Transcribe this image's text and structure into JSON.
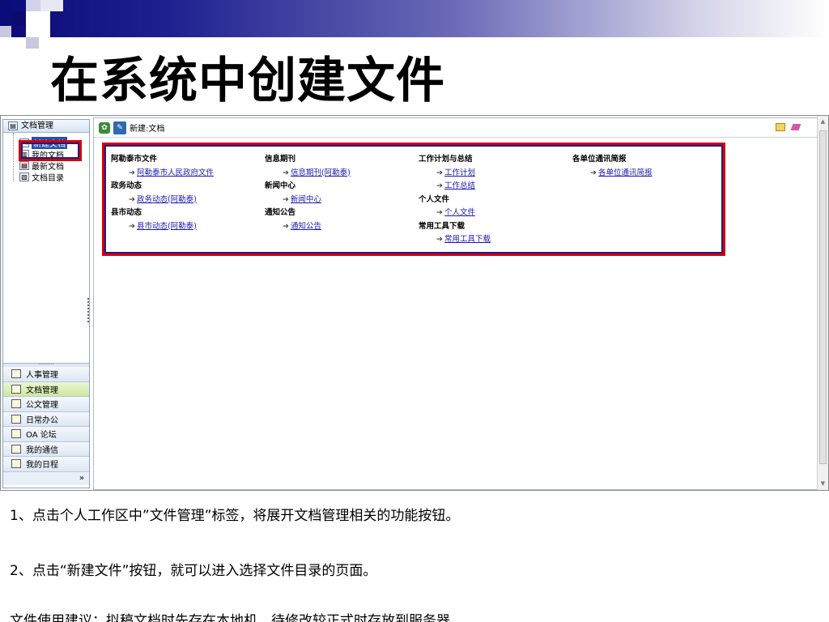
{
  "slide": {
    "title": "在系统中创建文件",
    "captions": [
      "1、点击个人工作区中”文件管理”标签，将展开文档管理相关的功能按钮。",
      "2、点击“新建文件”按钮，就可以进入选择文件目录的页面。",
      "文件使用建议：拟稿文档时先存在本地机，待修改较正式时存放到服务器"
    ]
  },
  "sidebar": {
    "header": "文档管理",
    "tree": [
      {
        "label": "新建文档",
        "selected": true,
        "icon": "new-doc-icon"
      },
      {
        "label": "我的文档",
        "selected": false,
        "icon": "my-doc-icon"
      },
      {
        "label": "最新文档",
        "selected": false,
        "icon": "latest-doc-icon"
      },
      {
        "label": "文档目录",
        "selected": false,
        "icon": "doc-catalog-icon"
      }
    ],
    "modules": [
      {
        "label": "人事管理",
        "icon": "personnel-icon",
        "active": false
      },
      {
        "label": "文档管理",
        "icon": "book-icon",
        "active": true
      },
      {
        "label": "公文管理",
        "icon": "official-doc-icon",
        "active": false
      },
      {
        "label": "日常办公",
        "icon": "office-icon",
        "active": false
      },
      {
        "label": "OA 论坛",
        "icon": "forum-icon",
        "active": false
      },
      {
        "label": "我的通信",
        "icon": "mail-icon",
        "active": false
      },
      {
        "label": "我的日程",
        "icon": "schedule-icon",
        "active": false
      }
    ],
    "more": "»"
  },
  "toolbar": {
    "label": "新建:文档"
  },
  "categories": [
    {
      "groups": [
        {
          "title": "阿勒泰市文件",
          "links": [
            "阿勒泰市人民政府文件"
          ]
        },
        {
          "title": "政务动态",
          "links": [
            "政务动态(阿勒泰)"
          ]
        },
        {
          "title": "县市动态",
          "links": [
            "县市动态(阿勒泰)"
          ]
        }
      ]
    },
    {
      "groups": [
        {
          "title": "信息期刊",
          "links": [
            "信息期刊(阿勒泰)"
          ]
        },
        {
          "title": "新闻中心",
          "links": [
            "新闻中心"
          ]
        },
        {
          "title": "通知公告",
          "links": [
            "通知公告"
          ]
        }
      ]
    },
    {
      "groups": [
        {
          "title": "工作计划与总结",
          "links": [
            "工作计划",
            "工作总结"
          ]
        },
        {
          "title": "个人文件",
          "links": [
            "个人文件"
          ]
        },
        {
          "title": "常用工具下载",
          "links": [
            "常用工具下载"
          ]
        }
      ]
    },
    {
      "groups": [
        {
          "title": "各单位通讯简报",
          "links": [
            "各单位通讯简报"
          ]
        }
      ]
    }
  ]
}
